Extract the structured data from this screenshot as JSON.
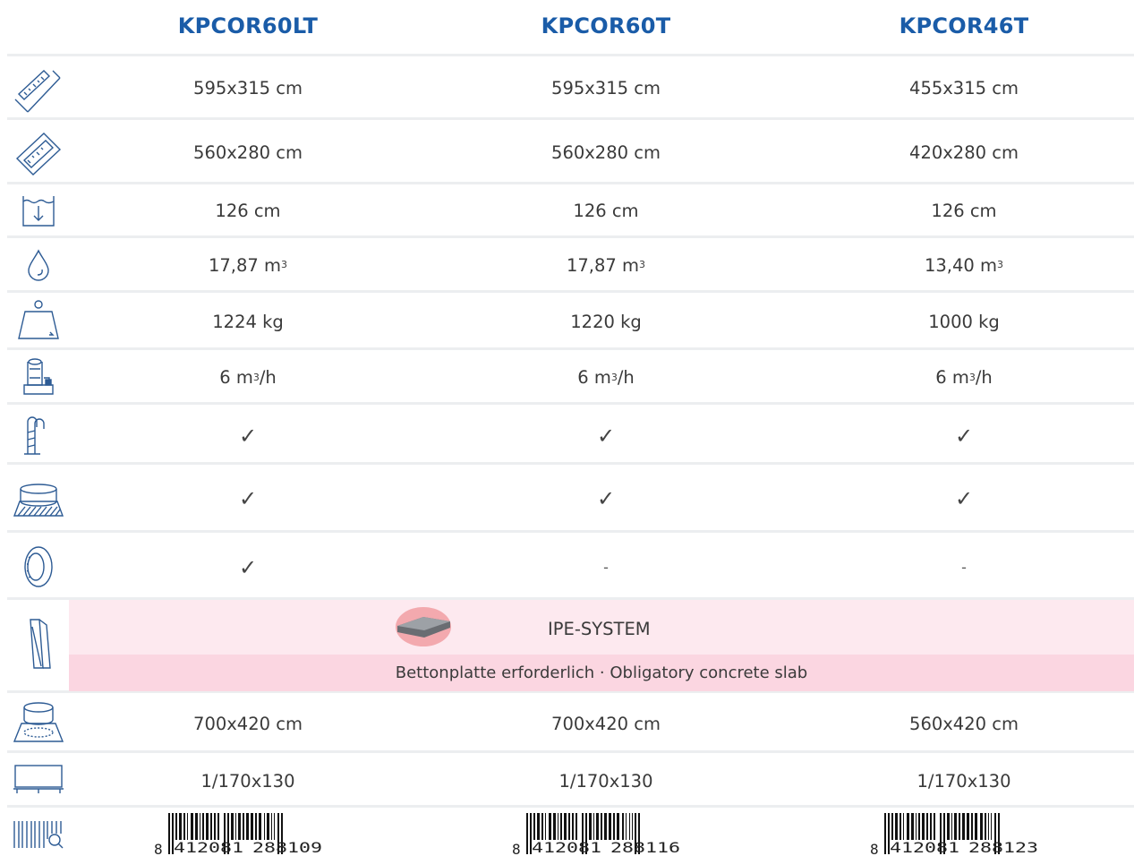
{
  "headers": [
    "KPCOR60LT",
    "KPCOR60T",
    "KPCOR46T"
  ],
  "rows": {
    "outer_size": [
      "595x315 cm",
      "595x315 cm",
      "455x315 cm"
    ],
    "inner_size": [
      "560x280 cm",
      "560x280 cm",
      "420x280 cm"
    ],
    "water_depth": [
      "126 cm",
      "126 cm",
      "126 cm"
    ],
    "volume": [
      {
        "num": "17,87 m",
        "sup": "3"
      },
      {
        "num": "17,87 m",
        "sup": "3"
      },
      {
        "num": "13,40 m",
        "sup": "3"
      }
    ],
    "weight": [
      "1224 kg",
      "1220 kg",
      "1000 kg"
    ],
    "filter": [
      {
        "pre": "6 m",
        "sup": "3",
        "post": "/h"
      },
      {
        "pre": "6 m",
        "sup": "3",
        "post": "/h"
      },
      {
        "pre": "6 m",
        "sup": "3",
        "post": "/h"
      }
    ],
    "ladder": [
      "✓",
      "✓",
      "✓"
    ],
    "ground_cloth": [
      "✓",
      "✓",
      "✓"
    ],
    "light": [
      "✓",
      "-",
      "-"
    ],
    "surface": [
      "700x420 cm",
      "700x420 cm",
      "560x420 cm"
    ],
    "pallet": [
      "1/170x130",
      "1/170x130",
      "1/170x130"
    ]
  },
  "ipe": {
    "label": "IPE-SYSTEM",
    "note": "Bettonplatte erforderlich · Obligatory concrete slab"
  },
  "barcodes": [
    {
      "lead": "8",
      "left": "412081",
      "right": "288109"
    },
    {
      "lead": "8",
      "left": "412081",
      "right": "288116"
    },
    {
      "lead": "8",
      "left": "412081",
      "right": "288123"
    }
  ],
  "colors": {
    "header": "#1a5ca8",
    "icon": "#2d5b94",
    "ipe_top": "#fde9ef",
    "ipe_bottom": "#fbd6e1",
    "divider": "#eceef0"
  },
  "icons": [
    "outer-dimensions-icon",
    "inner-dimensions-icon",
    "water-depth-icon",
    "water-volume-icon",
    "weight-icon",
    "filter-icon",
    "ladder-icon",
    "ground-cloth-icon",
    "pool-light-icon",
    "ipe-system-icon",
    "surface-needed-icon",
    "pallet-icon",
    "barcode-icon"
  ]
}
